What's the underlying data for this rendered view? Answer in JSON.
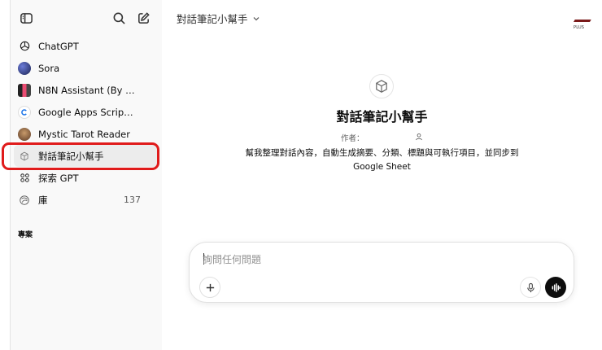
{
  "sidebar": {
    "items": [
      {
        "label": "ChatGPT",
        "icon": "chatgpt-logo-icon"
      },
      {
        "label": "Sora",
        "icon": "sora-avatar"
      },
      {
        "label": "N8N Assistant (By N...",
        "icon": "n8n-avatar"
      },
      {
        "label": "Google Apps Script ...",
        "icon": "apps-script-avatar"
      },
      {
        "label": "Mystic Tarot Reader",
        "icon": "tarot-avatar"
      },
      {
        "label": "對話筆記小幫手",
        "icon": "cube-icon"
      },
      {
        "label": "探索 GPT",
        "icon": "grid-icon"
      },
      {
        "label": "庫",
        "icon": "library-avatar",
        "count": "137"
      }
    ],
    "section_title": "專案",
    "active_index": 5
  },
  "header": {
    "model_selector": "對話筆記小幫手",
    "badge": "PLUS"
  },
  "gpt": {
    "title": "對話筆記小幫手",
    "author_label": "作者：",
    "description": "幫我整理對話內容，自動生成摘要、分類、標題與可執行項目，並同步到 Google Sheet"
  },
  "composer": {
    "placeholder": "詢問任何問題"
  },
  "colors": {
    "highlight": "#e01b1b",
    "sidebar_bg": "#f9f9f9",
    "voice_button": "#0d0d0d"
  }
}
